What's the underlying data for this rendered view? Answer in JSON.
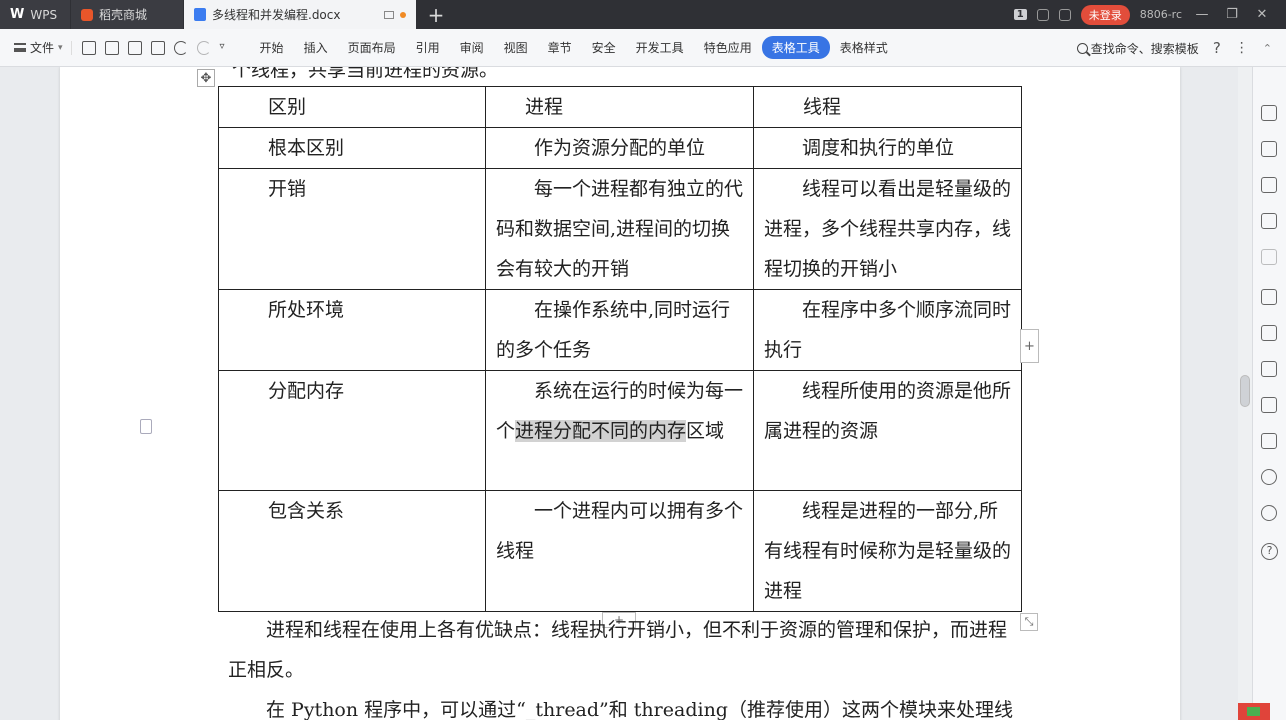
{
  "titlebar": {
    "app_tab": "WPS",
    "shop_tab": "稻壳商城",
    "doc_tab": "多线程和并发编程.docx",
    "new_tab": "+",
    "badge": "1",
    "login": "未登录",
    "user": "8806-rc",
    "minimize": "—",
    "restore": "❐",
    "close": "✕"
  },
  "menubar": {
    "file": "文件",
    "items": [
      "开始",
      "插入",
      "页面布局",
      "引用",
      "审阅",
      "视图",
      "章节",
      "安全",
      "开发工具",
      "特色应用",
      "表格工具",
      "表格样式"
    ],
    "active": "表格工具",
    "search": "查找命令、搜索模板",
    "help": "?",
    "more": "⋮"
  },
  "document": {
    "cut_line": "个线程，共享当前进程的资源。",
    "table": {
      "header": [
        "区别",
        "进程",
        "线程"
      ],
      "rows": [
        [
          "根本区别",
          "作为资源分配的单位",
          "调度和执行的单位"
        ],
        [
          "开销",
          "每一个进程都有独立的代码和数据空间,进程间的切换会有较大的开销",
          "线程可以看出是轻量级的进程，多个线程共享内存，线程切换的开销小"
        ],
        [
          "所处环境",
          "在操作系统中,同时运行的多个任务",
          "在程序中多个顺序流同时执行"
        ],
        [
          "分配内存",
          "系统在运行的时候为每一个进程分配不同的内存区域",
          "线程所使用的资源是他所属进程的资源"
        ],
        [
          "包含关系",
          "一个进程内可以拥有多个线程",
          "线程是进程的一部分,所有线程有时候称为是轻量级的进程"
        ]
      ],
      "highlight_before": "系统在运行的时候为每一个",
      "highlight": "进程分配不同的内存",
      "highlight_after": "区域"
    },
    "para1": "进程和线程在使用上各有优缺点：线程执行开销小，但不利于资源的管理和保护，而进程正相反。",
    "para2": "在 Python 程序中，可以通过“_thread”和 threading（推荐使用）这两个模块来处理线"
  }
}
